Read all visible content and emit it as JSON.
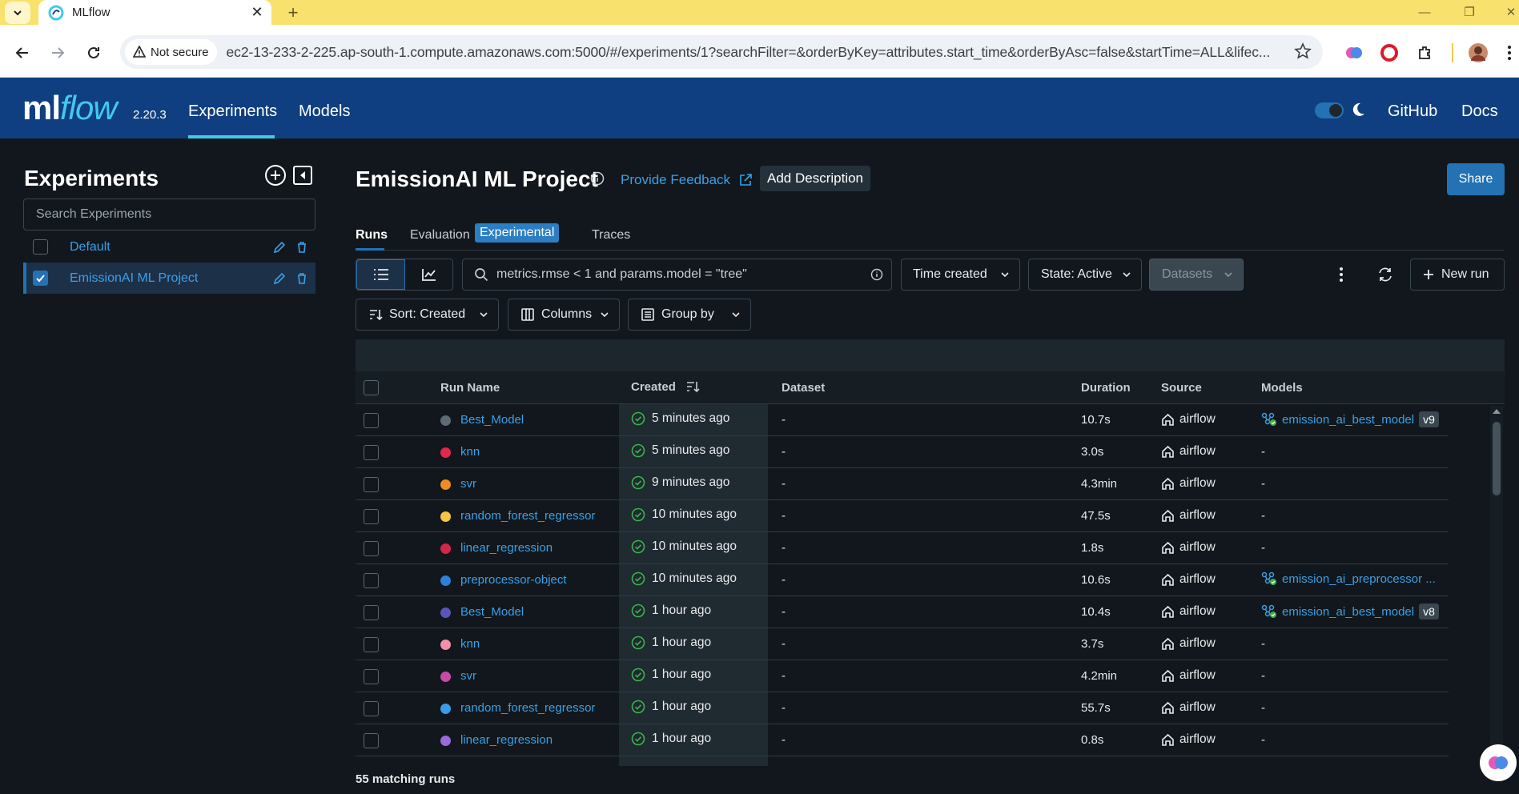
{
  "browser": {
    "tab_title": "MLflow",
    "security_label": "Not secure",
    "url": "ec2-13-233-2-225.ap-south-1.compute.amazonaws.com:5000/#/experiments/1?searchFilter=&orderByKey=attributes.start_time&orderByAsc=false&startTime=ALL&lifec..."
  },
  "header": {
    "logo_ml": "ml",
    "logo_flow": "flow",
    "version": "2.20.3",
    "nav": [
      {
        "label": "Experiments"
      },
      {
        "label": "Models"
      }
    ],
    "github": "GitHub",
    "docs": "Docs"
  },
  "sidebar": {
    "title": "Experiments",
    "search_placeholder": "Search Experiments",
    "items": [
      {
        "label": "Default",
        "checked": false
      },
      {
        "label": "EmissionAI ML Project",
        "checked": true
      }
    ]
  },
  "main": {
    "title": "EmissionAI ML Project",
    "feedback": "Provide Feedback",
    "add_description": "Add Description",
    "share": "Share",
    "tabs": [
      {
        "label": "Runs"
      },
      {
        "label": "Evaluation"
      },
      {
        "label": "Traces"
      }
    ],
    "experimental_badge": "Experimental",
    "search_placeholder": "metrics.rmse < 1 and params.model = \"tree\"",
    "time_created": "Time created",
    "state": "State: Active",
    "datasets": "Datasets",
    "new_run": "New run",
    "sort": "Sort: Created",
    "columns": "Columns",
    "group_by": "Group by",
    "matching": "55 matching runs"
  },
  "table": {
    "headers": {
      "run_name": "Run Name",
      "created": "Created",
      "dataset": "Dataset",
      "duration": "Duration",
      "source": "Source",
      "models": "Models"
    },
    "rows": [
      {
        "name": "Best_Model",
        "color": "#5f6b74",
        "created": "5 minutes ago",
        "dataset": "-",
        "duration": "10.7s",
        "source": "airflow",
        "model": "emission_ai_best_model",
        "version": "v9"
      },
      {
        "name": "knn",
        "color": "#e0284c",
        "created": "5 minutes ago",
        "dataset": "-",
        "duration": "3.0s",
        "source": "airflow",
        "model": "-",
        "version": ""
      },
      {
        "name": "svr",
        "color": "#f28b1f",
        "created": "9 minutes ago",
        "dataset": "-",
        "duration": "4.3min",
        "source": "airflow",
        "model": "-",
        "version": ""
      },
      {
        "name": "random_forest_regressor",
        "color": "#f7c544",
        "created": "10 minutes ago",
        "dataset": "-",
        "duration": "47.5s",
        "source": "airflow",
        "model": "-",
        "version": ""
      },
      {
        "name": "linear_regression",
        "color": "#d4254a",
        "created": "10 minutes ago",
        "dataset": "-",
        "duration": "1.8s",
        "source": "airflow",
        "model": "-",
        "version": ""
      },
      {
        "name": "preprocessor-object",
        "color": "#2f80d8",
        "created": "10 minutes ago",
        "dataset": "-",
        "duration": "10.6s",
        "source": "airflow",
        "model": "emission_ai_preprocessor ...",
        "version": ""
      },
      {
        "name": "Best_Model",
        "color": "#5b55b8",
        "created": "1 hour ago",
        "dataset": "-",
        "duration": "10.4s",
        "source": "airflow",
        "model": "emission_ai_best_model",
        "version": "v8"
      },
      {
        "name": "knn",
        "color": "#f38fa8",
        "created": "1 hour ago",
        "dataset": "-",
        "duration": "3.7s",
        "source": "airflow",
        "model": "-",
        "version": ""
      },
      {
        "name": "svr",
        "color": "#c84aa8",
        "created": "1 hour ago",
        "dataset": "-",
        "duration": "4.2min",
        "source": "airflow",
        "model": "-",
        "version": ""
      },
      {
        "name": "random_forest_regressor",
        "color": "#3a9be8",
        "created": "1 hour ago",
        "dataset": "-",
        "duration": "55.7s",
        "source": "airflow",
        "model": "-",
        "version": ""
      },
      {
        "name": "linear_regression",
        "color": "#9a6bd8",
        "created": "1 hour ago",
        "dataset": "-",
        "duration": "0.8s",
        "source": "airflow",
        "model": "-",
        "version": ""
      }
    ]
  }
}
